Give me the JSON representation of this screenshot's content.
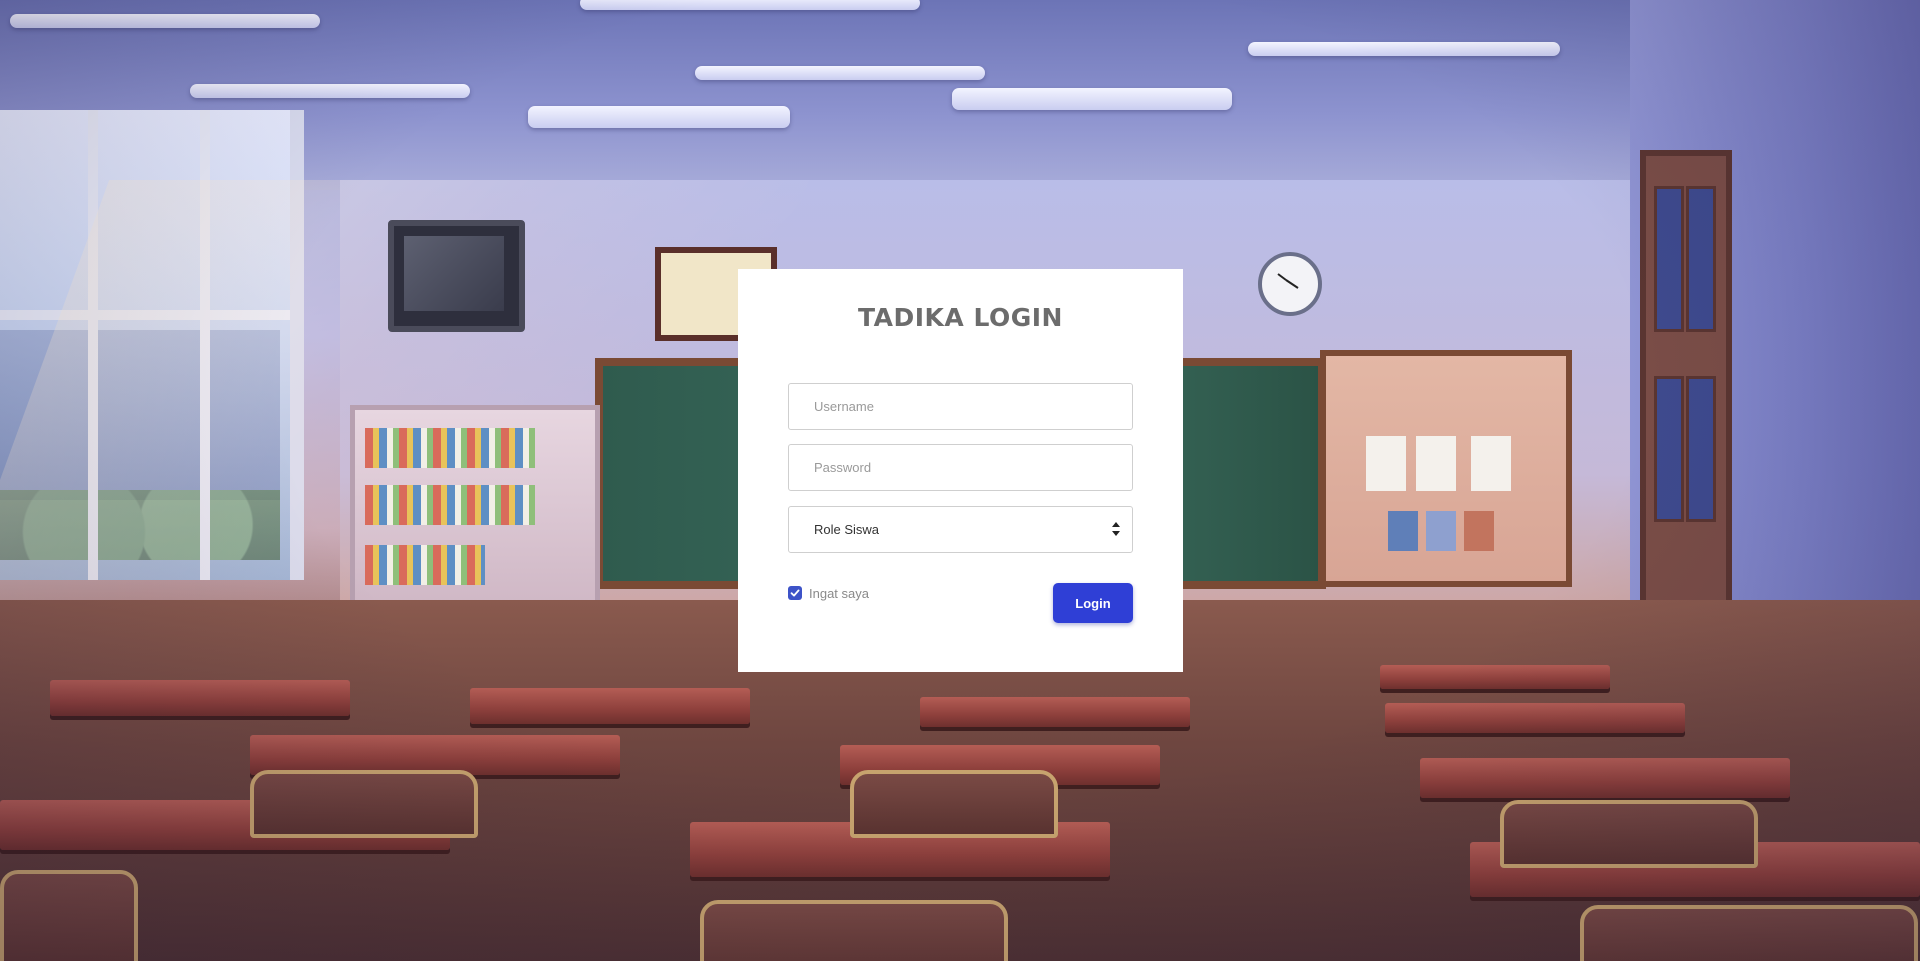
{
  "login": {
    "title": "TADIKA LOGIN",
    "username_placeholder": "Username",
    "password_placeholder": "Password",
    "role_selected": "Role Siswa",
    "remember_label": "Ingat saya",
    "remember_checked": true,
    "button_label": "Login"
  },
  "icons": {
    "select_arrow": "chevron-updown-icon",
    "checkbox": "check-icon"
  },
  "colors": {
    "button": "#2f3fd6",
    "checkbox": "#3d53c8",
    "title": "#6c6c6c"
  }
}
